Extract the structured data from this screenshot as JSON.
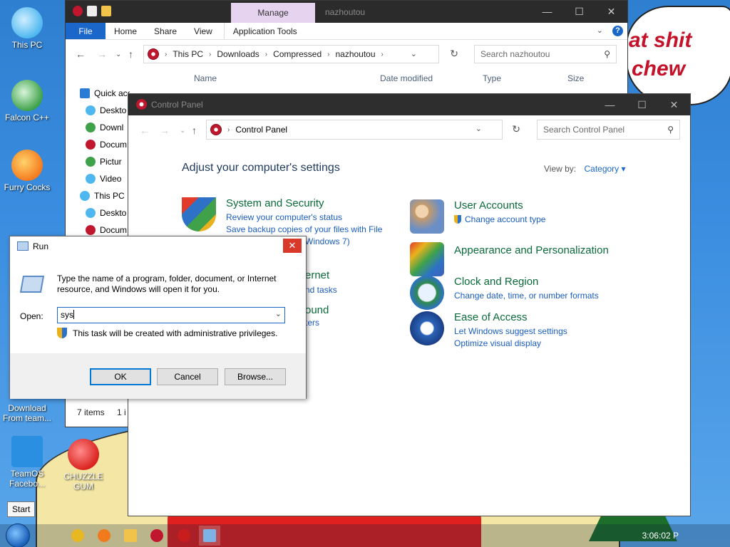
{
  "desktop": {
    "icons": [
      {
        "label": "This PC",
        "color": "#4fb7f0"
      },
      {
        "label": "Falcon C++",
        "color": "#3fa24a"
      },
      {
        "label": "Furry Cocks",
        "color": "#f57b1e"
      },
      {
        "label": "Download From team...",
        "color": "#2a7bd4"
      },
      {
        "label": "TeamOS Facebo...",
        "color": "#2a8fe0"
      },
      {
        "label": "CHUZZLE GUM",
        "color": "#d9231f"
      }
    ],
    "speech_lines": [
      "at shit",
      "chew"
    ],
    "start_tooltip": "Start"
  },
  "taskbar": {
    "clock": "3:06:02 P",
    "apps": [
      {
        "name": "chrome-icon",
        "color": "#e8b823"
      },
      {
        "name": "firefox-icon",
        "color": "#f07a1c"
      },
      {
        "name": "folder-icon",
        "color": "#f2c34b"
      },
      {
        "name": "control-panel-icon",
        "color": "#c0172e"
      },
      {
        "name": "red-ball-icon",
        "color": "#c71d1d"
      },
      {
        "name": "run-icon",
        "color": "#7eb3e8"
      }
    ]
  },
  "explorer": {
    "contextual_tab": "Manage",
    "title": "nazhoutou",
    "ribbon_tabs": [
      "File",
      "Home",
      "Share",
      "View",
      "Application Tools"
    ],
    "breadcrumb": [
      "This PC",
      "Downloads",
      "Compressed",
      "nazhoutou"
    ],
    "search_placeholder": "Search nazhoutou",
    "columns": [
      "Name",
      "Date modified",
      "Type",
      "Size"
    ],
    "nav_items": [
      {
        "label": "Quick access",
        "color": "#2a7bd4"
      },
      {
        "label": "Deskto",
        "color": "#4fb7f0"
      },
      {
        "label": "Downl",
        "color": "#3fa24a"
      },
      {
        "label": "Docum",
        "color": "#c0172e"
      },
      {
        "label": "Pictur",
        "color": "#3fa24a"
      },
      {
        "label": "Video",
        "color": "#4fb7f0"
      },
      {
        "label": "This PC",
        "color": "#4fb7f0"
      },
      {
        "label": "Deskto",
        "color": "#4fb7f0"
      },
      {
        "label": "Docum",
        "color": "#c0172e"
      }
    ],
    "status_items": "7 items",
    "status_extra": "1 i"
  },
  "control_panel": {
    "title": "Control Panel",
    "breadcrumb": "Control Panel",
    "search_placeholder": "Search Control Panel",
    "heading": "Adjust your computer's settings",
    "view_by_label": "View by:",
    "view_by_value": "Category",
    "categories": [
      {
        "title": "System and Security",
        "links": [
          "Review your computer's status",
          "Save backup copies of your files with File"
        ],
        "color": "#2d72c7"
      },
      {
        "title": "User Accounts",
        "links": [
          "Change account type"
        ],
        "color": "#c79b6a"
      },
      {
        "title": "Appearance and Personalization",
        "links": [],
        "color": "#3f5fb8"
      },
      {
        "title": "Clock and Region",
        "links": [
          "Change date, time, or number formats"
        ],
        "color": "#2f8a4a"
      },
      {
        "title": "Ease of Access",
        "links": [
          "Let Windows suggest settings",
          "Optimize visual display"
        ],
        "color": "#2d64b8"
      }
    ],
    "partial_texts": [
      "Windows 7)",
      "ernet",
      "nd tasks",
      "ound",
      "ters"
    ]
  },
  "run": {
    "title": "Run",
    "description": "Type the name of a program, folder, document, or Internet resource, and Windows will open it for you.",
    "open_label": "Open:",
    "open_value": "sys",
    "admin_note": "This task will be created with administrative privileges.",
    "ok_label": "OK",
    "cancel_label": "Cancel",
    "browse_label": "Browse..."
  }
}
